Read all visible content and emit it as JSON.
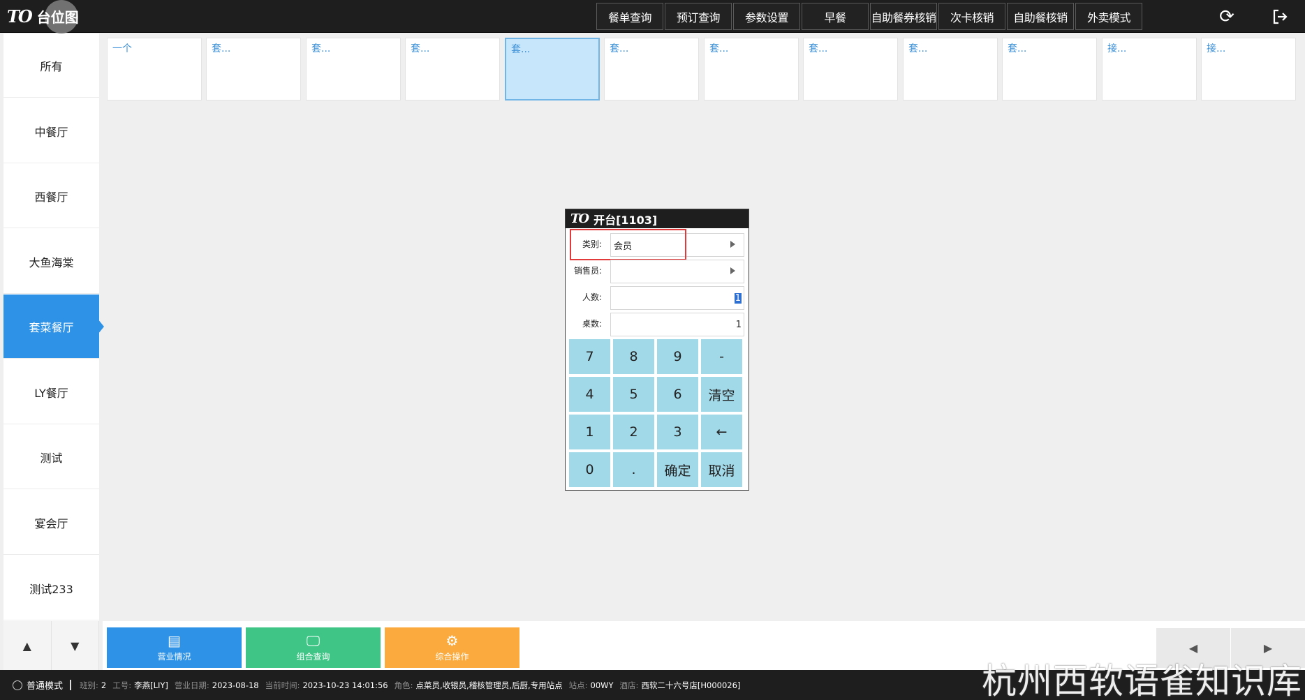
{
  "app": {
    "logo_mark": "TO",
    "title": "台位图"
  },
  "top_nav": [
    "餐单查询",
    "预订查询",
    "参数设置",
    "早餐",
    "自助餐券核销",
    "次卡核销",
    "自助餐核销",
    "外卖模式"
  ],
  "top_icons": {
    "refresh": "refresh-icon",
    "logout": "logout-icon"
  },
  "sidebar": {
    "items": [
      "所有",
      "中餐厅",
      "西餐厅",
      "大鱼海棠",
      "套菜餐厅",
      "LY餐厅",
      "测试",
      "宴会厅",
      "测试233"
    ],
    "active": "套菜餐厅",
    "up_arrow": "▲",
    "down_arrow": "▼"
  },
  "tables": [
    "一个",
    "套...",
    "套...",
    "套...",
    "套...",
    "套...",
    "套...",
    "套...",
    "套...",
    "套...",
    "接...",
    "接..."
  ],
  "selected_table": 4,
  "dialog": {
    "logo_mark": "TO",
    "title": "开台[1103]",
    "fields": {
      "category_label": "类别:",
      "category_value": "会员",
      "salesperson_label": "销售员:",
      "salesperson_value": "",
      "guests_label": "人数:",
      "guests_value": "1",
      "tables_label": "桌数:",
      "tables_value": "1"
    },
    "keys": [
      "7",
      "8",
      "9",
      "-",
      "4",
      "5",
      "6",
      "清空",
      "1",
      "2",
      "3",
      "←",
      "0",
      ".",
      "确定",
      "取消"
    ]
  },
  "actions": [
    {
      "label": "营业情况",
      "icon": "▤",
      "color": "#2e92e6"
    },
    {
      "label": "组合查询",
      "icon": "🖵",
      "color": "#3fc586"
    },
    {
      "label": "综合操作",
      "icon": "⚙",
      "color": "#fbab3d"
    }
  ],
  "pager": {
    "prev": "◀",
    "next": "▶"
  },
  "status": {
    "mode": "普通模式",
    "shift_label": "班别:",
    "shift": "2",
    "employee_label": "工号:",
    "employee": "李燕[LIY]",
    "business_date_label": "营业日期:",
    "business_date": "2023-08-18",
    "current_time_label": "当前时间:",
    "current_time": "2023-10-23 14:01:56",
    "role_label": "角色:",
    "role": "点菜员,收银员,稽核管理员,后厨,专用站点",
    "station_label": "站点:",
    "station": "00WY",
    "hotel_label": "酒店:",
    "hotel": "西软二十六号店[H000026]"
  },
  "watermark": "杭州西软语雀知识库"
}
